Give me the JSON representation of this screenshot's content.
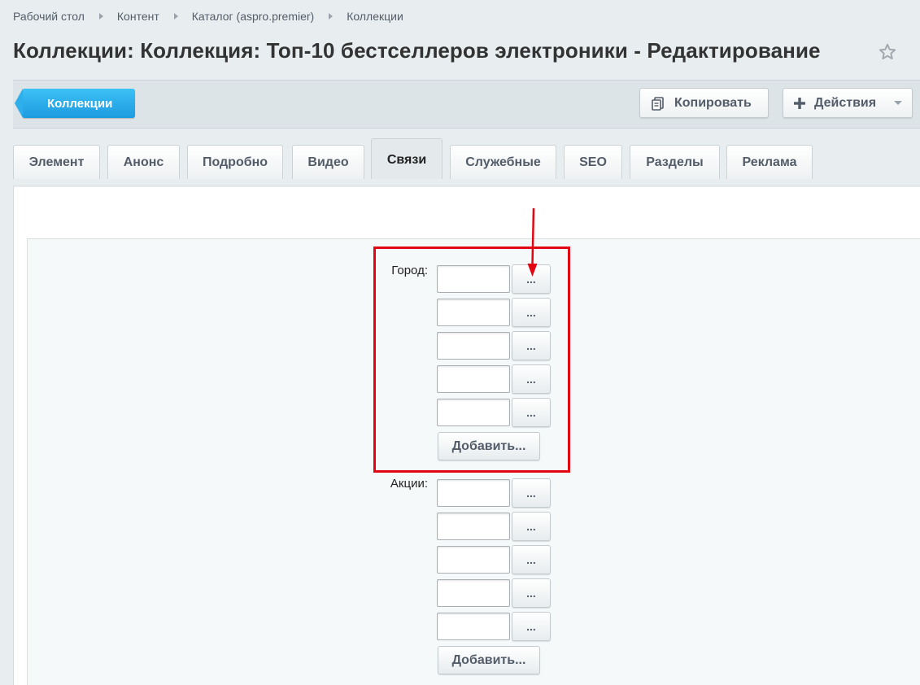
{
  "breadcrumb": {
    "items": [
      "Рабочий стол",
      "Контент",
      "Каталог (aspro.premier)",
      "Коллекции"
    ]
  },
  "page": {
    "title": "Коллекции: Коллекция: Топ-10 бестселлеров электроники - Редактирование"
  },
  "toolbar": {
    "back_label": "Коллекции",
    "copy_label": "Копировать",
    "actions_label": "Действия"
  },
  "tabs": [
    {
      "label": "Элемент"
    },
    {
      "label": "Анонс"
    },
    {
      "label": "Подробно"
    },
    {
      "label": "Видео"
    },
    {
      "label": "Связи"
    },
    {
      "label": "Служебные"
    },
    {
      "label": "SEO"
    },
    {
      "label": "Разделы"
    },
    {
      "label": "Реклама"
    }
  ],
  "active_tab": "Связи",
  "form": {
    "city": {
      "label": "Город:",
      "pick_label": "...",
      "add_label": "Добавить...",
      "values": [
        "",
        "",
        "",
        "",
        ""
      ]
    },
    "promos": {
      "label": "Акции:",
      "pick_label": "...",
      "add_label": "Добавить...",
      "values": [
        "",
        "",
        "",
        "",
        ""
      ]
    }
  },
  "colors": {
    "accent": "#1d9be0",
    "annotation": "#e20613"
  },
  "icons": {
    "favorite": "star-icon",
    "copy": "copy-icon",
    "actions": "plus-icon",
    "dropdown": "chevron-down-icon"
  }
}
